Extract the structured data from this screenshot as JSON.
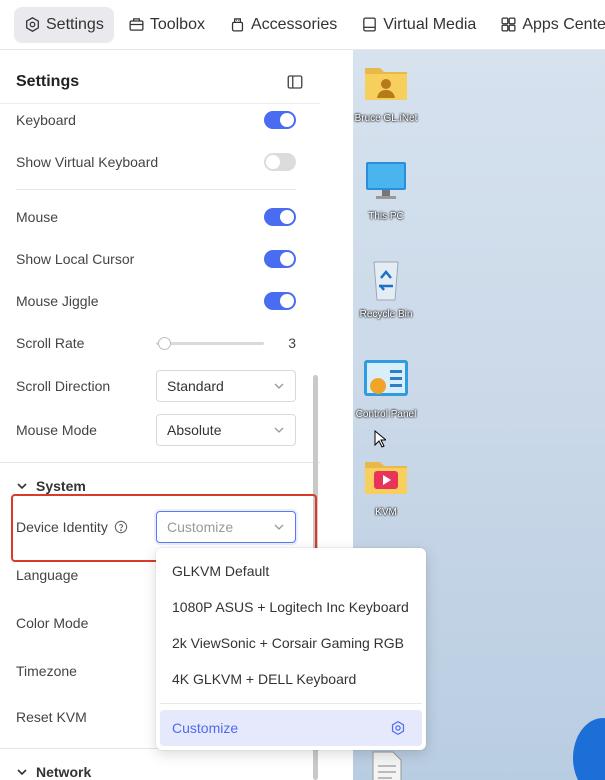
{
  "tabs": [
    {
      "label": "Settings",
      "icon": "settings-icon",
      "active": true
    },
    {
      "label": "Toolbox",
      "icon": "toolbox-icon"
    },
    {
      "label": "Accessories",
      "icon": "accessories-icon"
    },
    {
      "label": "Virtual Media",
      "icon": "virtual-media-icon"
    },
    {
      "label": "Apps Center",
      "icon": "apps-center-icon"
    }
  ],
  "panel": {
    "title": "Settings",
    "keyboard_label": "Keyboard",
    "keyboard_on": true,
    "virtual_keyboard_label": "Show Virtual Keyboard",
    "virtual_keyboard_on": false,
    "mouse_label": "Mouse",
    "mouse_on": true,
    "local_cursor_label": "Show Local Cursor",
    "local_cursor_on": true,
    "mouse_jiggle_label": "Mouse Jiggle",
    "mouse_jiggle_on": true,
    "scroll_rate_label": "Scroll Rate",
    "scroll_rate_value": "3",
    "scroll_direction_label": "Scroll Direction",
    "scroll_direction_value": "Standard",
    "mouse_mode_label": "Mouse Mode",
    "mouse_mode_value": "Absolute",
    "system_section": "System",
    "device_identity_label": "Device Identity",
    "device_identity_placeholder": "Customize",
    "language_label": "Language",
    "color_mode_label": "Color Mode",
    "timezone_label": "Timezone",
    "reset_label": "Reset KVM",
    "network_section": "Network"
  },
  "dropdown": {
    "options": [
      "GLKVM Default",
      "1080P ASUS + Logitech Inc Keyboard",
      "2k ViewSonic + Corsair Gaming RGB",
      "4K GLKVM + DELL Keyboard"
    ],
    "selected": "Customize"
  },
  "desktop": {
    "icons": [
      "Bruce GL.iNet",
      "This PC",
      "Recycle Bin",
      "Control Panel",
      "KVM"
    ]
  },
  "colors": {
    "accent": "#4a6cf0",
    "highlight": "#d93b2b"
  }
}
